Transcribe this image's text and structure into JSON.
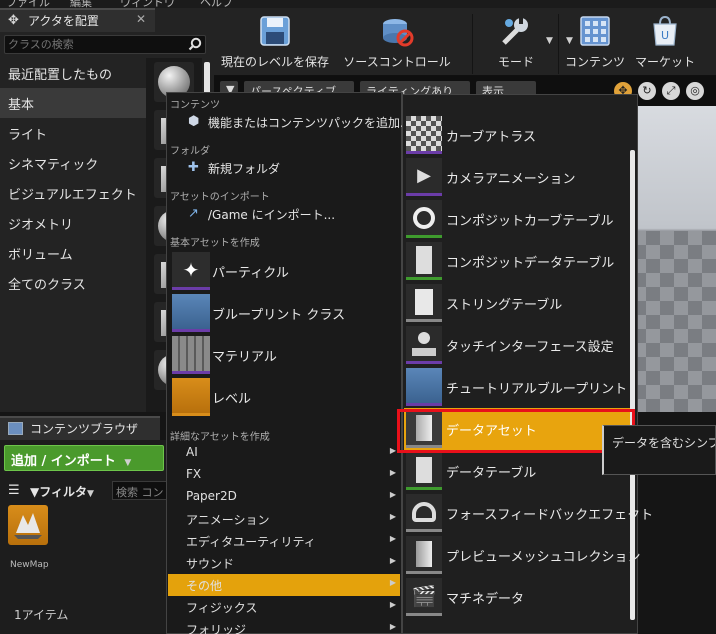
{
  "menubar": {
    "items": [
      "ファイル",
      "編集",
      "ウィンドウ",
      "ヘルプ"
    ]
  },
  "place_actors": {
    "tab_title": "アクタを配置",
    "search_placeholder": "クラスの検索",
    "categories": [
      "最近配置したもの",
      "基本",
      "ライト",
      "シネマティック",
      "ビジュアルエフェクト",
      "ジオメトリ",
      "ボリューム",
      "全てのクラス"
    ],
    "active_category": "基本"
  },
  "toolbar": {
    "buttons": [
      {
        "label": "現在のレベルを保存",
        "icon": "save-icon"
      },
      {
        "label": "ソースコントロール",
        "icon": "source-control-icon"
      },
      {
        "label": "モード",
        "icon": "modes-icon"
      },
      {
        "label": "コンテンツ",
        "icon": "content-icon"
      },
      {
        "label": "マーケット",
        "icon": "marketplace-icon"
      }
    ]
  },
  "viewport": {
    "perspective": "パースペクティブ",
    "lighting": "ライティングあり",
    "show": "表示"
  },
  "content_browser": {
    "tab_title": "コンテンツブラウザ",
    "add_import": "追加 / インポート",
    "filter": "フィルタ",
    "search_placeholder": "検索 コン",
    "asset_name": "NewMap",
    "item_count": "1アイテム"
  },
  "context_menu": {
    "section_content": "コンテンツ",
    "add_feature": "機能またはコンテンツパックを追加...",
    "section_folder": "フォルダ",
    "new_folder": "新規フォルダ",
    "section_import": "アセットのインポート",
    "import_game": "/Game にインポート...",
    "section_basic": "基本アセットを作成",
    "basic_assets": [
      "パーティクル",
      "ブループリント クラス",
      "マテリアル",
      "レベル"
    ],
    "section_advanced": "詳細なアセットを作成",
    "advanced_categories": [
      "AI",
      "FX",
      "Paper2D",
      "アニメーション",
      "エディタユーティリティ",
      "サウンド",
      "その他",
      "フィジックス",
      "フォリッジ"
    ],
    "selected_category": "その他"
  },
  "submenu": {
    "items": [
      "カーブアトラス",
      "カメラアニメーション",
      "コンポジットカーブテーブル",
      "コンポジットデータテーブル",
      "ストリングテーブル",
      "タッチインターフェース設定",
      "チュートリアルブループリント",
      "データアセット",
      "データテーブル",
      "フォースフィードバックエフェクト",
      "プレビューメッシュコレクション",
      "マチネデータ"
    ],
    "selected": "データアセット"
  },
  "tooltip": {
    "text": "データを含むシンプル"
  },
  "colors": {
    "highlight": "#e8a40e",
    "annotation_box": "#e8101a",
    "add_button": "#4a9a2c",
    "blueprint_bar": "#6b3ca8",
    "table_bar": "#3f9b2e"
  }
}
